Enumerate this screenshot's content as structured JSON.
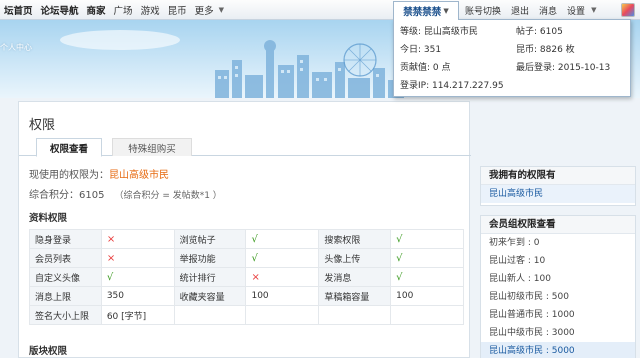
{
  "topnav": {
    "left_items": [
      {
        "label": "坛首页",
        "bold": true
      },
      {
        "label": "论坛导航",
        "bold": true
      },
      {
        "label": "商家",
        "bold": true
      },
      {
        "label": "广场",
        "bold": false
      },
      {
        "label": "游戏",
        "bold": false
      },
      {
        "label": "昆币",
        "bold": false
      },
      {
        "label": "更多",
        "bold": false
      }
    ],
    "username": "禁禁禁禁",
    "right_items": [
      "账号切换",
      "退出",
      "消息",
      "设置"
    ]
  },
  "banner": {
    "message": "个人中心"
  },
  "dropdown": {
    "level": "等级: 昆山高级市民",
    "posts": "帖子: 6105",
    "today": "今日: 351",
    "kunbi": "昆币: 8826 枚",
    "contribution": "贡献值: 0 点",
    "last_login": "最后登录: 2015-10-13",
    "login_ip": "登录IP: 114.217.227.95"
  },
  "main": {
    "title": "权限",
    "tabs": [
      {
        "label": "权限查看",
        "active": true
      },
      {
        "label": "特殊组购买",
        "active": false
      }
    ],
    "current_perm_label": "现使用的权限为：",
    "current_perm_value": "昆山高级市民",
    "score_label": "综合积分：6105",
    "score_formula": "（综合积分 = 发帖数*1 ）",
    "section_resource": "资料权限",
    "section_board": "版块权限",
    "table": [
      [
        {
          "label": "隐身登录",
          "value": "×",
          "type": "no"
        },
        {
          "label": "浏览帖子",
          "value": "√",
          "type": "yes"
        },
        {
          "label": "搜索权限",
          "value": "√",
          "type": "yes"
        }
      ],
      [
        {
          "label": "会员列表",
          "value": "×",
          "type": "no"
        },
        {
          "label": "举报功能",
          "value": "√",
          "type": "yes"
        },
        {
          "label": "头像上传",
          "value": "√",
          "type": "yes"
        }
      ],
      [
        {
          "label": "自定义头像",
          "value": "√",
          "type": "yes"
        },
        {
          "label": "统计排行",
          "value": "×",
          "type": "no"
        },
        {
          "label": "发消息",
          "value": "√",
          "type": "yes"
        }
      ],
      [
        {
          "label": "消息上限",
          "value": "350",
          "type": "text"
        },
        {
          "label": "收藏夹容量",
          "value": "100",
          "type": "text"
        },
        {
          "label": "草稿箱容量",
          "value": "100",
          "type": "text"
        }
      ],
      [
        {
          "label": "签名大小上限",
          "value": "60 [字节]",
          "type": "text"
        },
        null,
        null
      ]
    ]
  },
  "sidebar": {
    "my_perm_title": "我拥有的权限有",
    "my_perm_item": "昆山高级市民",
    "group_title": "会员组权限查看",
    "groups": [
      {
        "label": "初来乍到 : 0",
        "selected": false
      },
      {
        "label": "昆山过客 : 10",
        "selected": false
      },
      {
        "label": "昆山新人 : 100",
        "selected": false
      },
      {
        "label": "昆山初级市民 : 500",
        "selected": false
      },
      {
        "label": "昆山普通市民 : 1000",
        "selected": false
      },
      {
        "label": "昆山中级市民 : 3000",
        "selected": false
      },
      {
        "label": "昆山高级市民 : 5000",
        "selected": true
      }
    ]
  }
}
